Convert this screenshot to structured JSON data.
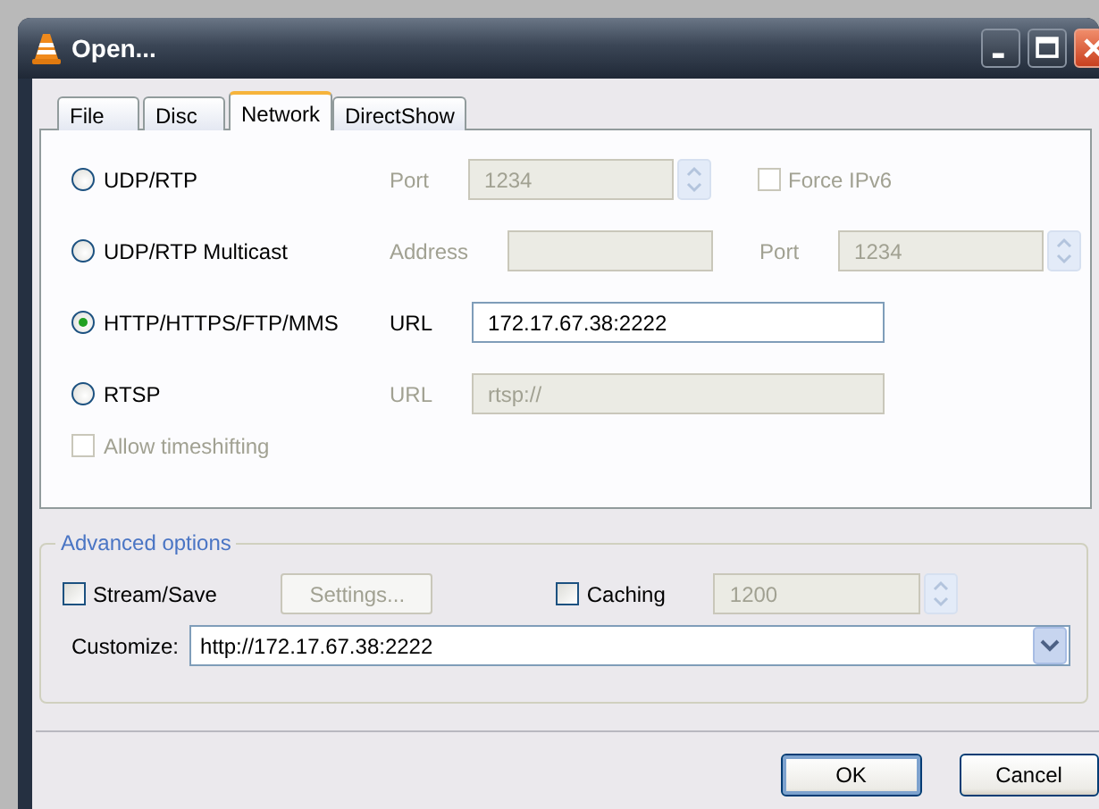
{
  "window": {
    "title": "Open..."
  },
  "tabs": [
    {
      "label": "File",
      "selected": false
    },
    {
      "label": "Disc",
      "selected": false
    },
    {
      "label": "Network",
      "selected": true
    },
    {
      "label": "DirectShow",
      "selected": false
    }
  ],
  "protocols": [
    {
      "label": "UDP/RTP",
      "selected": false,
      "fields": [
        {
          "kind": "spin",
          "label": "Port",
          "value": "1234",
          "disabled": true
        },
        {
          "kind": "checkbox",
          "label": "Force IPv6",
          "checked": false,
          "disabled": true
        }
      ]
    },
    {
      "label": "UDP/RTP Multicast",
      "selected": false,
      "fields": [
        {
          "kind": "text",
          "label": "Address",
          "disabled": true
        },
        {
          "kind": "spin",
          "label": "Port",
          "value": "1234",
          "disabled": true
        }
      ]
    },
    {
      "label": "HTTP/HTTPS/FTP/MMS",
      "selected": true,
      "fields": [
        {
          "kind": "url",
          "label": "URL",
          "value": "172.17.67.38:2222",
          "disabled": false
        }
      ]
    },
    {
      "label": "RTSP",
      "selected": false,
      "fields": [
        {
          "kind": "url",
          "label": "URL",
          "value": "rtsp://",
          "disabled": true
        }
      ]
    }
  ],
  "timeshifting": {
    "label": "Allow timeshifting",
    "checked": false,
    "disabled": true
  },
  "advanced": {
    "title": "Advanced options",
    "stream_save": {
      "label": "Stream/Save",
      "checked": false
    },
    "settings_button": {
      "label": "Settings...",
      "disabled": true
    },
    "caching": {
      "label": "Caching",
      "checked": false
    },
    "caching_value": {
      "value": "1200",
      "disabled": true
    },
    "customize": {
      "label": "Customize:",
      "value": "http://172.17.67.38:2222"
    }
  },
  "buttons": [
    {
      "label": "OK",
      "default": true
    },
    {
      "label": "Cancel",
      "default": false
    }
  ]
}
